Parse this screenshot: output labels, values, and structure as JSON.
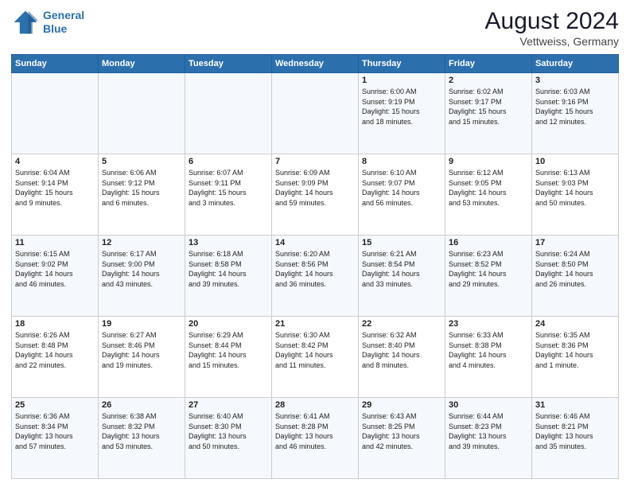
{
  "logo": {
    "line1": "General",
    "line2": "Blue"
  },
  "title": "August 2024",
  "location": "Vettweiss, Germany",
  "days_header": [
    "Sunday",
    "Monday",
    "Tuesday",
    "Wednesday",
    "Thursday",
    "Friday",
    "Saturday"
  ],
  "weeks": [
    [
      {
        "num": "",
        "info": ""
      },
      {
        "num": "",
        "info": ""
      },
      {
        "num": "",
        "info": ""
      },
      {
        "num": "",
        "info": ""
      },
      {
        "num": "1",
        "info": "Sunrise: 6:00 AM\nSunset: 9:19 PM\nDaylight: 15 hours\nand 18 minutes."
      },
      {
        "num": "2",
        "info": "Sunrise: 6:02 AM\nSunset: 9:17 PM\nDaylight: 15 hours\nand 15 minutes."
      },
      {
        "num": "3",
        "info": "Sunrise: 6:03 AM\nSunset: 9:16 PM\nDaylight: 15 hours\nand 12 minutes."
      }
    ],
    [
      {
        "num": "4",
        "info": "Sunrise: 6:04 AM\nSunset: 9:14 PM\nDaylight: 15 hours\nand 9 minutes."
      },
      {
        "num": "5",
        "info": "Sunrise: 6:06 AM\nSunset: 9:12 PM\nDaylight: 15 hours\nand 6 minutes."
      },
      {
        "num": "6",
        "info": "Sunrise: 6:07 AM\nSunset: 9:11 PM\nDaylight: 15 hours\nand 3 minutes."
      },
      {
        "num": "7",
        "info": "Sunrise: 6:09 AM\nSunset: 9:09 PM\nDaylight: 14 hours\nand 59 minutes."
      },
      {
        "num": "8",
        "info": "Sunrise: 6:10 AM\nSunset: 9:07 PM\nDaylight: 14 hours\nand 56 minutes."
      },
      {
        "num": "9",
        "info": "Sunrise: 6:12 AM\nSunset: 9:05 PM\nDaylight: 14 hours\nand 53 minutes."
      },
      {
        "num": "10",
        "info": "Sunrise: 6:13 AM\nSunset: 9:03 PM\nDaylight: 14 hours\nand 50 minutes."
      }
    ],
    [
      {
        "num": "11",
        "info": "Sunrise: 6:15 AM\nSunset: 9:02 PM\nDaylight: 14 hours\nand 46 minutes."
      },
      {
        "num": "12",
        "info": "Sunrise: 6:17 AM\nSunset: 9:00 PM\nDaylight: 14 hours\nand 43 minutes."
      },
      {
        "num": "13",
        "info": "Sunrise: 6:18 AM\nSunset: 8:58 PM\nDaylight: 14 hours\nand 39 minutes."
      },
      {
        "num": "14",
        "info": "Sunrise: 6:20 AM\nSunset: 8:56 PM\nDaylight: 14 hours\nand 36 minutes."
      },
      {
        "num": "15",
        "info": "Sunrise: 6:21 AM\nSunset: 8:54 PM\nDaylight: 14 hours\nand 33 minutes."
      },
      {
        "num": "16",
        "info": "Sunrise: 6:23 AM\nSunset: 8:52 PM\nDaylight: 14 hours\nand 29 minutes."
      },
      {
        "num": "17",
        "info": "Sunrise: 6:24 AM\nSunset: 8:50 PM\nDaylight: 14 hours\nand 26 minutes."
      }
    ],
    [
      {
        "num": "18",
        "info": "Sunrise: 6:26 AM\nSunset: 8:48 PM\nDaylight: 14 hours\nand 22 minutes."
      },
      {
        "num": "19",
        "info": "Sunrise: 6:27 AM\nSunset: 8:46 PM\nDaylight: 14 hours\nand 19 minutes."
      },
      {
        "num": "20",
        "info": "Sunrise: 6:29 AM\nSunset: 8:44 PM\nDaylight: 14 hours\nand 15 minutes."
      },
      {
        "num": "21",
        "info": "Sunrise: 6:30 AM\nSunset: 8:42 PM\nDaylight: 14 hours\nand 11 minutes."
      },
      {
        "num": "22",
        "info": "Sunrise: 6:32 AM\nSunset: 8:40 PM\nDaylight: 14 hours\nand 8 minutes."
      },
      {
        "num": "23",
        "info": "Sunrise: 6:33 AM\nSunset: 8:38 PM\nDaylight: 14 hours\nand 4 minutes."
      },
      {
        "num": "24",
        "info": "Sunrise: 6:35 AM\nSunset: 8:36 PM\nDaylight: 14 hours\nand 1 minute."
      }
    ],
    [
      {
        "num": "25",
        "info": "Sunrise: 6:36 AM\nSunset: 8:34 PM\nDaylight: 13 hours\nand 57 minutes."
      },
      {
        "num": "26",
        "info": "Sunrise: 6:38 AM\nSunset: 8:32 PM\nDaylight: 13 hours\nand 53 minutes."
      },
      {
        "num": "27",
        "info": "Sunrise: 6:40 AM\nSunset: 8:30 PM\nDaylight: 13 hours\nand 50 minutes."
      },
      {
        "num": "28",
        "info": "Sunrise: 6:41 AM\nSunset: 8:28 PM\nDaylight: 13 hours\nand 46 minutes."
      },
      {
        "num": "29",
        "info": "Sunrise: 6:43 AM\nSunset: 8:25 PM\nDaylight: 13 hours\nand 42 minutes."
      },
      {
        "num": "30",
        "info": "Sunrise: 6:44 AM\nSunset: 8:23 PM\nDaylight: 13 hours\nand 39 minutes."
      },
      {
        "num": "31",
        "info": "Sunrise: 6:46 AM\nSunset: 8:21 PM\nDaylight: 13 hours\nand 35 minutes."
      }
    ]
  ]
}
